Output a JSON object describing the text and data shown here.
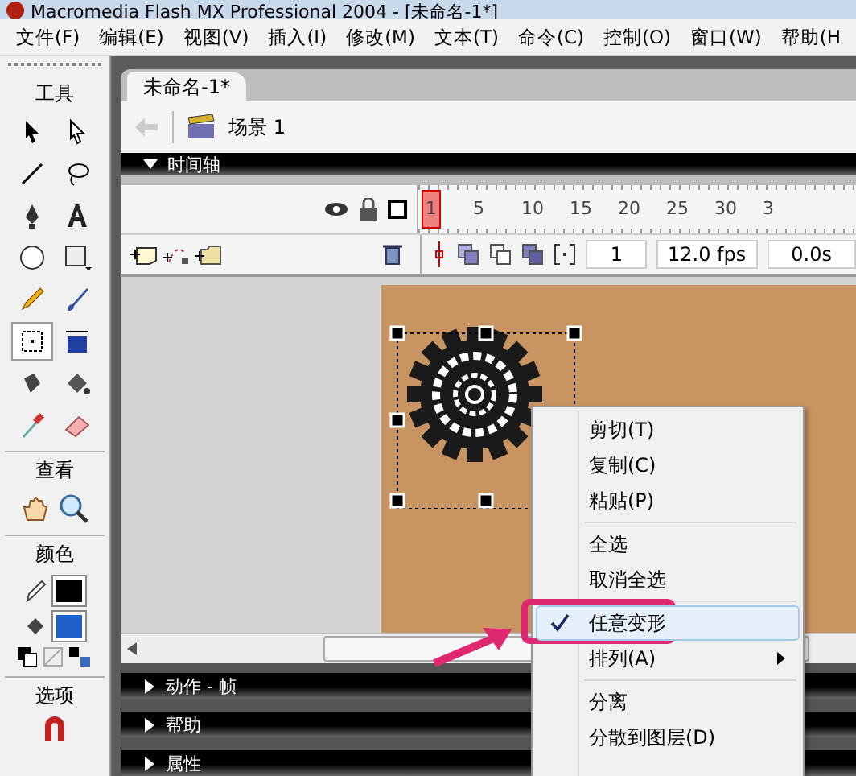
{
  "window": {
    "title": "Macromedia Flash MX Professional 2004 - [未命名-1*]"
  },
  "menu_bar": [
    "文件(F)",
    "编辑(E)",
    "视图(V)",
    "插入(I)",
    "修改(M)",
    "文本(T)",
    "命令(C)",
    "控制(O)",
    "窗口(W)",
    "帮助(H"
  ],
  "toolbox": {
    "title": "工具",
    "tools": [
      {
        "kind": "arrow",
        "selected": false
      },
      {
        "kind": "subselect",
        "selected": false
      },
      {
        "kind": "line",
        "selected": false
      },
      {
        "kind": "lasso",
        "selected": false
      },
      {
        "kind": "pen",
        "selected": false
      },
      {
        "kind": "text",
        "selected": false
      },
      {
        "kind": "oval",
        "selected": false
      },
      {
        "kind": "rect",
        "selected": false
      },
      {
        "kind": "pencil",
        "selected": false
      },
      {
        "kind": "brush",
        "selected": false
      },
      {
        "kind": "transform",
        "selected": true
      },
      {
        "kind": "gradient",
        "selected": false
      },
      {
        "kind": "ink",
        "selected": false
      },
      {
        "kind": "bucket",
        "selected": false
      },
      {
        "kind": "dropper",
        "selected": false
      },
      {
        "kind": "eraser",
        "selected": false
      }
    ],
    "view_title": "查看",
    "colors_title": "颜色",
    "swatches": [
      {
        "kind": "stroke",
        "color": "#000000"
      },
      {
        "kind": "fill",
        "color": "#1f5fc8"
      }
    ],
    "options_title": "选项"
  },
  "document": {
    "tab": "未命名-1*",
    "scene": "场景 1"
  },
  "timeline": {
    "title": "时间轴",
    "expanded": true,
    "frame_numbers": [
      "1",
      "5",
      "10",
      "15",
      "20",
      "25",
      "30",
      "3"
    ],
    "current_frame": "1",
    "fps": "12.0 fps",
    "time": "0.0s"
  },
  "context_menu": [
    {
      "kind": "item",
      "label": "剪切(T)",
      "checked": false,
      "highlighted": false
    },
    {
      "kind": "item",
      "label": "复制(C)",
      "checked": false,
      "highlighted": false
    },
    {
      "kind": "item",
      "label": "粘贴(P)",
      "checked": false,
      "highlighted": false
    },
    {
      "kind": "separator"
    },
    {
      "kind": "item",
      "label": "全选",
      "checked": false,
      "highlighted": false
    },
    {
      "kind": "item",
      "label": "取消全选",
      "checked": false,
      "highlighted": false
    },
    {
      "kind": "separator"
    },
    {
      "kind": "item",
      "label": "任意变形",
      "checked": true,
      "highlighted": true
    },
    {
      "kind": "submenu",
      "label": "排列(A)",
      "checked": false,
      "highlighted": false
    },
    {
      "kind": "separator"
    },
    {
      "kind": "item",
      "label": "分离",
      "checked": false,
      "highlighted": false
    },
    {
      "kind": "item",
      "label": "分散到图层(D)",
      "checked": false,
      "highlighted": false
    }
  ],
  "panels": [
    {
      "title": "动作 - 帧",
      "expanded": false
    },
    {
      "title": "帮助",
      "expanded": false
    },
    {
      "title": "属性",
      "expanded": false
    }
  ]
}
